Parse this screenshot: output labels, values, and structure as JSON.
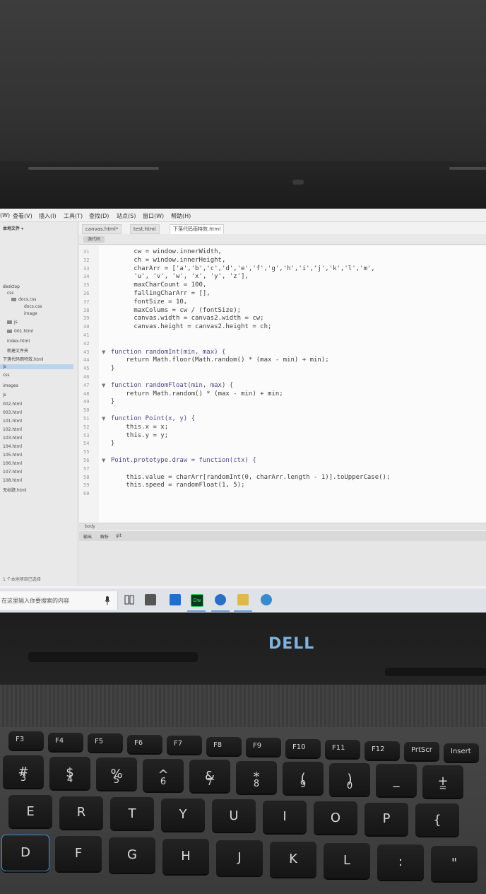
{
  "menubar": [
    "(W)",
    "查看(V)",
    "插入(I)",
    "工具(T)",
    "查找(D)",
    "站点(S)",
    "窗口(W)",
    "帮助(H)"
  ],
  "tabs": [
    "canvas.html*",
    "test.html",
    "下落代码雨特效.html"
  ],
  "subbar_label": "源代码",
  "sidebar": {
    "header": "本地文件 ▾",
    "items": [
      "desktop",
      "css",
      "docs.css",
      "docs.css",
      "image",
      "js",
      "001.html",
      "index.html",
      "新建文件夹",
      "下落代码雨特效.html",
      "js",
      "css",
      "images",
      "js",
      "002.html",
      "003.html",
      "101.html",
      "102.html",
      "103.html",
      "104.html",
      "105.html",
      "106.html",
      "107.html",
      "108.html",
      "无标题.html"
    ],
    "footer": "1 个本地项目已选择"
  },
  "code_lines": [
    {
      "text": "        cw = window.innerWidth,",
      "kw": false
    },
    {
      "text": "        ch = window.innerHeight,",
      "kw": false
    },
    {
      "text": "        charArr = ['a','b','c','d','e','f','g','h','i','j','k','l','m',",
      "kw": false
    },
    {
      "text": "        'u', 'v', 'w', 'x', 'y', 'z'],",
      "kw": false
    },
    {
      "text": "        maxCharCount = 100,",
      "kw": false
    },
    {
      "text": "        fallingCharArr = [],",
      "kw": false
    },
    {
      "text": "        fontSize = 10,",
      "kw": false
    },
    {
      "text": "        maxColums = cw / (fontSize);",
      "kw": false
    },
    {
      "text": "        canvas.width = canvas2.width = cw;",
      "kw": false
    },
    {
      "text": "        canvas.height = canvas2.height = ch;",
      "kw": false
    },
    {
      "text": "",
      "kw": false
    },
    {
      "text": "",
      "kw": false
    },
    {
      "text": "  function randomInt(min, max) {",
      "kw": true
    },
    {
      "text": "      return Math.floor(Math.random() * (max - min) + min);",
      "kw": false
    },
    {
      "text": "  }",
      "kw": false
    },
    {
      "text": "",
      "kw": false
    },
    {
      "text": "  function randomFloat(min, max) {",
      "kw": true
    },
    {
      "text": "      return Math.random() * (max - min) + min;",
      "kw": false
    },
    {
      "text": "  }",
      "kw": false
    },
    {
      "text": "",
      "kw": false
    },
    {
      "text": "  function Point(x, y) {",
      "kw": true
    },
    {
      "text": "      this.x = x;",
      "kw": false
    },
    {
      "text": "      this.y = y;",
      "kw": false
    },
    {
      "text": "  }",
      "kw": false
    },
    {
      "text": "",
      "kw": false
    },
    {
      "text": "  Point.prototype.draw = function(ctx) {",
      "kw": true
    },
    {
      "text": "",
      "kw": false
    },
    {
      "text": "      this.value = charArr[randomInt(0, charArr.length - 1)].toUpperCase();",
      "kw": false
    },
    {
      "text": "      this.speed = randomFloat(1, 5);",
      "kw": false
    },
    {
      "text": "",
      "kw": false
    }
  ],
  "status_bar": "body",
  "status_tabs": [
    "输出",
    "解析",
    "git"
  ],
  "taskbar": {
    "search_placeholder": "在这里输入你要搜索的内容",
    "dw_label": "Dw"
  },
  "brand": "DELL",
  "keys": {
    "fn_row": [
      "F3",
      "F4",
      "F5",
      "F6",
      "F7",
      "F8",
      "F9",
      "F10",
      "F11",
      "F12",
      "PrtScr",
      "Insert"
    ],
    "num_row": [
      {
        "top": "#",
        "bottom": "3"
      },
      {
        "top": "$",
        "bottom": "4"
      },
      {
        "top": "%",
        "bottom": "5"
      },
      {
        "top": "^",
        "bottom": "6"
      },
      {
        "top": "&",
        "bottom": "7"
      },
      {
        "top": "*",
        "bottom": "8"
      },
      {
        "top": "(",
        "bottom": "9"
      },
      {
        "top": ")",
        "bottom": "0"
      },
      {
        "top": "_",
        "bottom": "-"
      },
      {
        "top": "+",
        "bottom": "="
      }
    ],
    "row_qwerty": [
      "E",
      "R",
      "T",
      "Y",
      "U",
      "I",
      "O",
      "P",
      "{"
    ],
    "row_home": [
      "D",
      "F",
      "G",
      "H",
      "J",
      "K",
      "L",
      ":",
      "\""
    ]
  },
  "colors": {
    "accent_key": "#3b8fd6",
    "dell_logo": "#7fb4e0",
    "dw_green": "#35c45a"
  }
}
